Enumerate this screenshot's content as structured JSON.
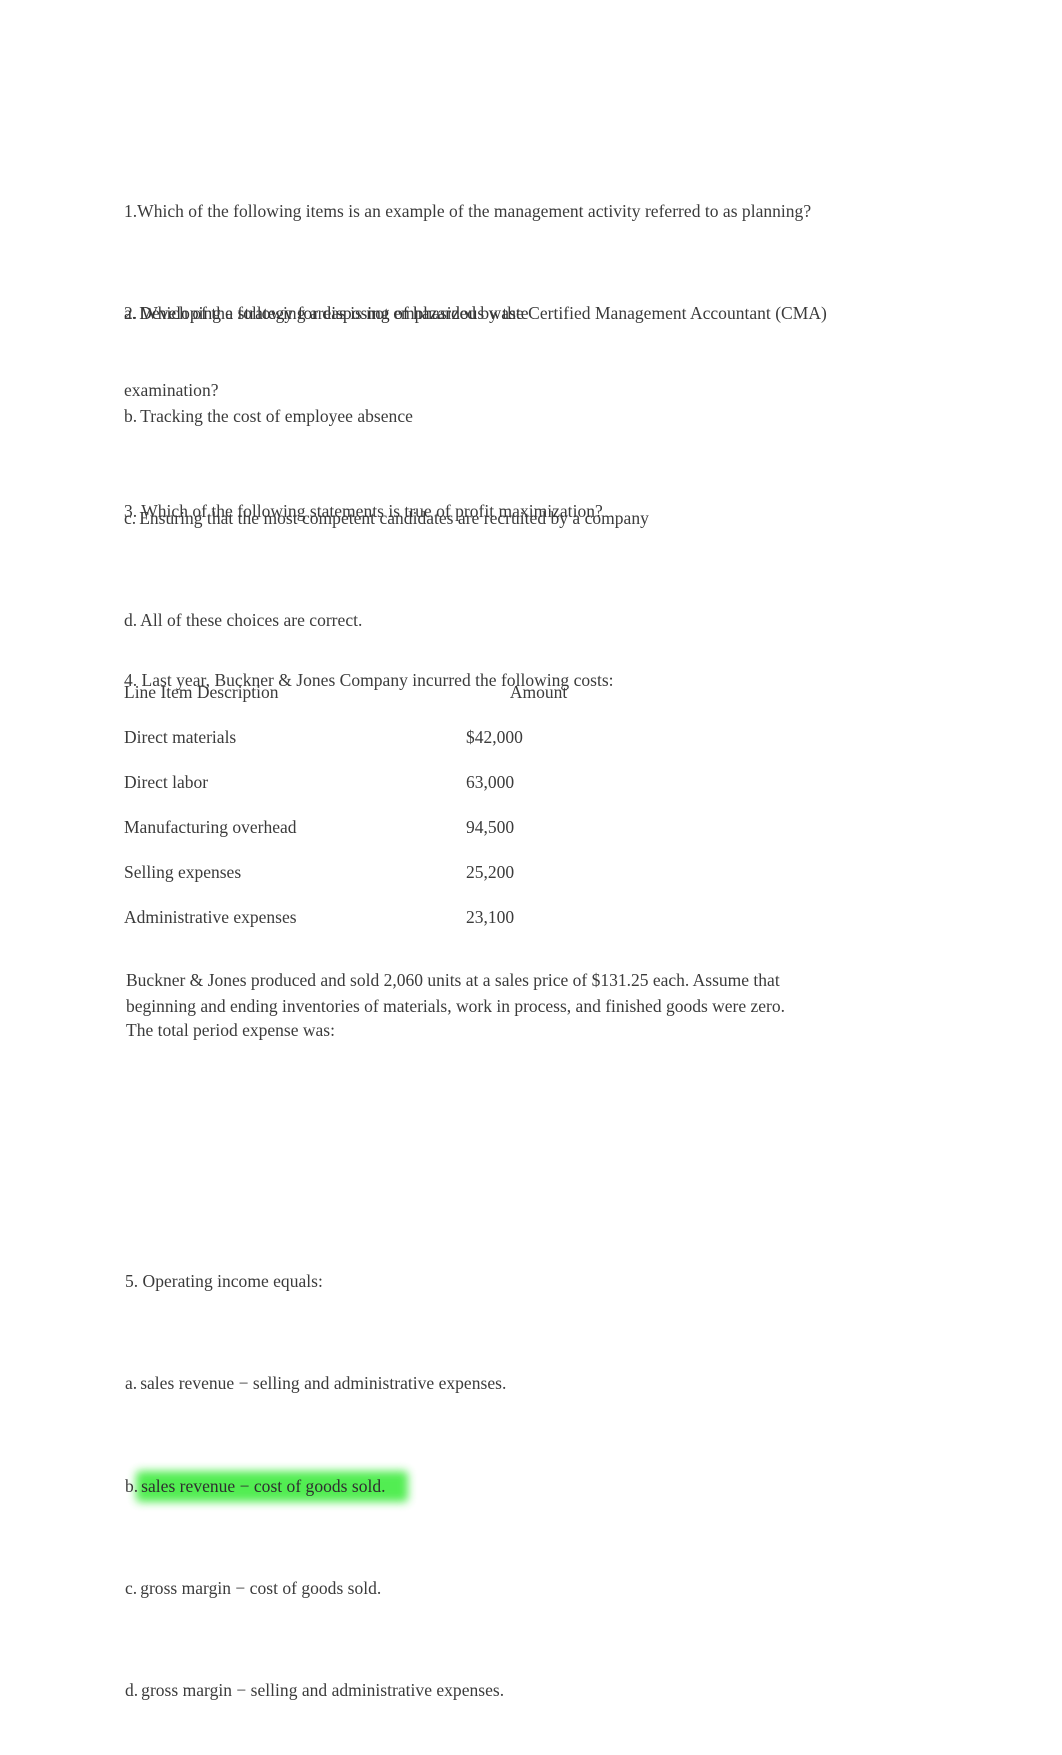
{
  "document": {
    "background_color": "#ffffff",
    "text_color": "#3b3b3b",
    "highlight_color": "#44ec44"
  },
  "question1": {
    "prompt": "1.Which of the following items is an example of the management activity referred to as planning?",
    "options": [
      {
        "marker": "a.",
        "text": "Developing a strategy for disposing of hazardous waste",
        "highlighted": true
      },
      {
        "marker": "b.",
        "text": "Tracking the cost of employee absence",
        "highlighted": false
      },
      {
        "marker": "c.",
        "text": "Ensuring that the most competent candidates are recruited by a company",
        "highlighted": false
      },
      {
        "marker": "d.",
        "text": "All of these choices are correct.",
        "highlighted": false
      }
    ]
  },
  "question2": {
    "prompt_line1": "2. Which of the following areas is not emphasized by the Certified Management Accountant (CMA)",
    "prompt_line2": "examination?"
  },
  "question3": {
    "prompt": "3. Which of the following statements is true of profit maximization?"
  },
  "question4": {
    "prompt": "4. Last year, Buckner & Jones Company incurred the following costs:",
    "table": {
      "headers": [
        "Line Item Description",
        "Amount"
      ],
      "rows": [
        [
          "Direct materials",
          "$42,000"
        ],
        [
          "Direct labor",
          "63,000"
        ],
        [
          "Manufacturing overhead",
          "94,500"
        ],
        [
          "Selling expenses",
          "25,200"
        ],
        [
          "Administrative expenses",
          "23,100"
        ]
      ]
    },
    "paragraph_line1": "Buckner & Jones produced and sold 2,060 units at a sales price of $131.25 each. Assume that",
    "paragraph_line2": "beginning and ending inventories of materials, work in process, and finished goods were zero.",
    "paragraph_line3": "The total period expense was:"
  },
  "question5": {
    "prompt": "5. Operating income equals:",
    "options": [
      {
        "marker": "a.",
        "text": "sales revenue − selling and administrative expenses.",
        "highlighted": false
      },
      {
        "marker": "b.",
        "text": "sales revenue − cost of goods sold.",
        "highlighted": true
      },
      {
        "marker": "c.",
        "text": "gross margin − cost of goods sold.",
        "highlighted": false
      },
      {
        "marker": "d.",
        "text": "gross margin − selling and administrative expenses.",
        "highlighted": false
      }
    ]
  }
}
